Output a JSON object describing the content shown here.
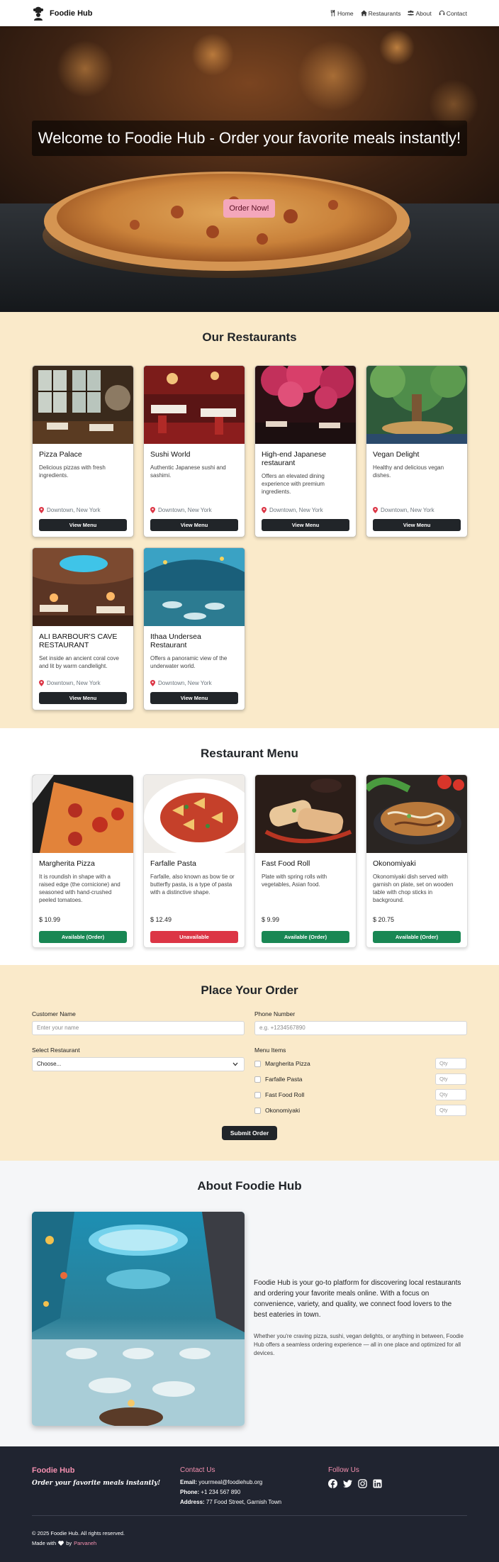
{
  "brand": {
    "name": "Foodie Hub",
    "logo_icon": "chef-icon"
  },
  "nav": {
    "items": [
      {
        "label": "Home",
        "icon": "utensils-icon"
      },
      {
        "label": "Restaurants",
        "icon": "house-icon"
      },
      {
        "label": "About",
        "icon": "users-icon"
      },
      {
        "label": "Contact",
        "icon": "headset-icon"
      }
    ]
  },
  "hero": {
    "title": "Welcome to Foodie Hub - Order your favorite meals instantly!",
    "cta": "Order Now!"
  },
  "restaurants": {
    "title": "Our Restaurants",
    "items": [
      {
        "name": "Pizza Palace",
        "desc": "Delicious pizzas with fresh ingredients.",
        "location": "Downtown, New York",
        "button": "View Menu"
      },
      {
        "name": "Sushi World",
        "desc": "Authentic Japanese sushi and sashimi.",
        "location": "Downtown, New York",
        "button": "View Menu"
      },
      {
        "name": "High-end Japanese restaurant",
        "desc": "Offers an elevated dining experience with premium ingredients.",
        "location": "Downtown, New York",
        "button": "View Menu"
      },
      {
        "name": "Vegan Delight",
        "desc": "Healthy and delicious vegan dishes.",
        "location": "Downtown, New York",
        "button": "View Menu"
      },
      {
        "name": "ALI BARBOUR'S CAVE RESTAURANT",
        "desc": "Set inside an ancient coral cove and lit by warm candlelight.",
        "location": "Downtown, New York",
        "button": "View Menu"
      },
      {
        "name": "Ithaa Undersea Restaurant",
        "desc": "Offers a panoramic view of the underwater world.",
        "location": "Downtown, New York",
        "button": "View Menu"
      }
    ]
  },
  "menu": {
    "title": "Restaurant Menu",
    "items": [
      {
        "name": "Margherita Pizza",
        "desc": "It is roundish in shape with a raised edge (the cornicione) and seasoned with hand-crushed peeled tomatoes.",
        "price": "$ 10.99",
        "status": "Available (Order)",
        "status_color": "#198754"
      },
      {
        "name": "Farfalle Pasta",
        "desc": "Farfalle, also known as bow tie or butterfly pasta, is a type of pasta with a distinctive shape.",
        "price": "$ 12.49",
        "status": "Unavailable",
        "status_color": "#dc3545"
      },
      {
        "name": "Fast Food Roll",
        "desc": "Plate with spring rolls with vegetables, Asian food.",
        "price": "$ 9.99",
        "status": "Available (Order)",
        "status_color": "#198754"
      },
      {
        "name": "Okonomiyaki",
        "desc": "Okonomiyaki dish served with garnish on plate, set on wooden table with chop sticks in background.",
        "price": "$ 20.75",
        "status": "Available (Order)",
        "status_color": "#198754"
      }
    ]
  },
  "order": {
    "title": "Place Your Order",
    "customer_label": "Customer Name",
    "customer_placeholder": "Enter your name",
    "phone_label": "Phone Number",
    "phone_placeholder": "e.g. +1234567890",
    "restaurant_label": "Select Restaurant",
    "restaurant_value": "Choose...",
    "items_label": "Menu Items",
    "items": [
      "Margherita Pizza",
      "Farfalle Pasta",
      "Fast Food Roll",
      "Okonomiyaki"
    ],
    "qty_placeholder": "Qty",
    "submit": "Submit Order"
  },
  "about": {
    "title": "About Foodie Hub",
    "lead": "Foodie Hub is your go-to platform for discovering local restaurants and ordering your favorite meals online. With a focus on convenience, variety, and quality, we connect food lovers to the best eateries in town.",
    "sub": "Whether you're craving pizza, sushi, vegan delights, or anything in between, Foodie Hub offers a seamless ordering experience — all in one place and optimized for all devices."
  },
  "footer": {
    "brand": "Foodie Hub",
    "tagline": "Order your favorite meals instantly!",
    "contact_title": "Contact Us",
    "email_label": "Email:",
    "email": "yourmeal@foodiehub.org",
    "phone_label": "Phone:",
    "phone": "+1 234 567 890",
    "address_label": "Address:",
    "address": "77 Food Street, Garnish Town",
    "follow_title": "Follow Us",
    "socials": [
      "facebook-icon",
      "twitter-icon",
      "instagram-icon",
      "linkedin-icon"
    ],
    "copyright": "© 2025 Foodie Hub. All rights reserved.",
    "made_with": "Made with",
    "by": "by",
    "author": "Parvaneh"
  }
}
